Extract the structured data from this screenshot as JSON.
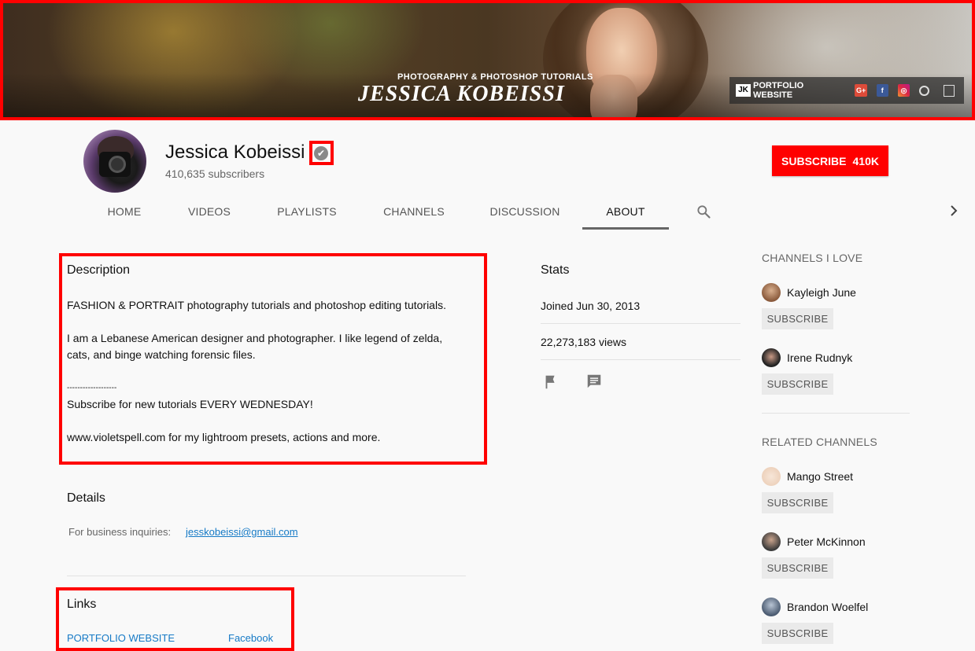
{
  "banner": {
    "subtitle": "PHOTOGRAPHY & PHOTOSHOP TUTORIALS",
    "title": "JESSICA KOBEISSI",
    "jk_logo": "JK",
    "link_label": "PORTFOLIO WEBSITE",
    "social_icons": [
      "google-plus-icon",
      "facebook-icon",
      "instagram-icon",
      "globe-icon",
      "square-icon"
    ],
    "gplus_glyph": "G+",
    "fb_glyph": "f",
    "ig_glyph": "◎"
  },
  "channel": {
    "name": "Jessica Kobeissi",
    "subscribers": "410,635 subscribers",
    "verified_glyph": "✔",
    "subscribe_label": "SUBSCRIBE",
    "subscribe_count": "410K"
  },
  "tabs": [
    {
      "label": "HOME"
    },
    {
      "label": "VIDEOS"
    },
    {
      "label": "PLAYLISTS"
    },
    {
      "label": "CHANNELS"
    },
    {
      "label": "DISCUSSION"
    },
    {
      "label": "ABOUT",
      "active": true
    }
  ],
  "about": {
    "description_title": "Description",
    "description_lines": [
      "FASHION & PORTRAIT photography tutorials and photoshop editing tutorials.",
      "I am a Lebanese American designer and photographer. I like legend of zelda,",
      "cats, and binge watching forensic files.",
      "-------------------",
      "Subscribe for new tutorials EVERY WEDNESDAY!",
      "www.violetspell.com for my lightroom presets, actions and more."
    ],
    "details_title": "Details",
    "business_label": "For business inquiries:",
    "business_email": "jesskobeissi@gmail.com",
    "links_title": "Links",
    "links": [
      "PORTFOLIO WEBSITE",
      "Facebook"
    ]
  },
  "stats": {
    "title": "Stats",
    "joined": "Joined Jun 30, 2013",
    "views": "22,273,183 views"
  },
  "sidebar": {
    "channels_title": "CHANNELS I LOVE",
    "channels": [
      {
        "name": "Kayleigh June",
        "subscribe": "SUBSCRIBE"
      },
      {
        "name": "Irene Rudnyk",
        "subscribe": "SUBSCRIBE"
      }
    ],
    "related_title": "RELATED CHANNELS",
    "related": [
      {
        "name": "Mango Street",
        "subscribe": "SUBSCRIBE"
      },
      {
        "name": "Peter McKinnon",
        "subscribe": "SUBSCRIBE"
      },
      {
        "name": "Brandon Woelfel",
        "subscribe": "SUBSCRIBE"
      }
    ]
  },
  "colors": {
    "subscribe_red": "#ff0000",
    "link_blue": "#167ac6",
    "highlight_red": "#ff0000"
  }
}
